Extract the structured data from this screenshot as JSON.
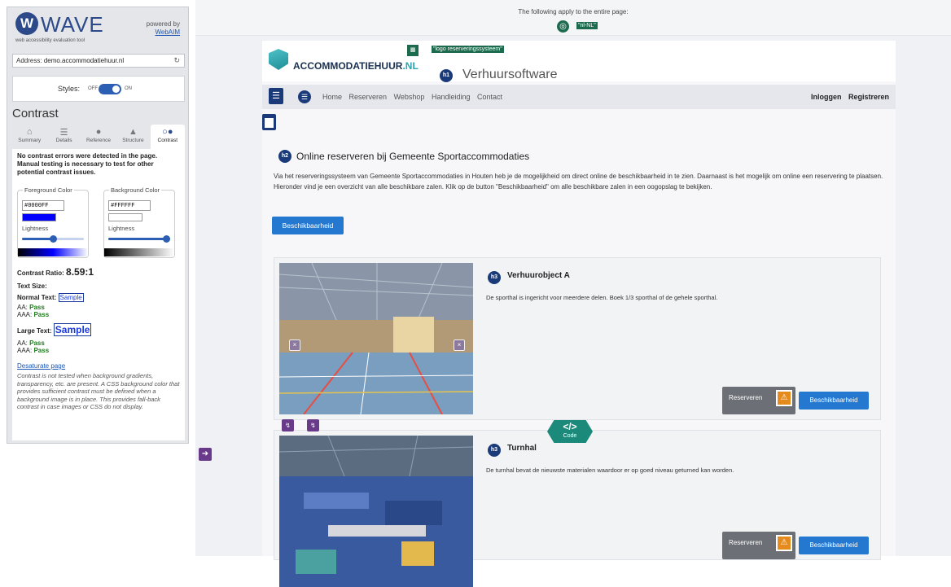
{
  "wave": {
    "title": "WAVE",
    "subtitle": "web accessibility evaluation tool",
    "powered_by": "powered by",
    "webaim": "WebAIM",
    "address_label": "Address:",
    "address_value": "demo.accommodatiehuur.nl",
    "styles_label": "Styles:",
    "styles_off": "OFF",
    "styles_on": "ON",
    "contrast_heading": "Contrast",
    "tabs": [
      {
        "label": "Summary",
        "icon": "home-icon"
      },
      {
        "label": "Details",
        "icon": "list-icon"
      },
      {
        "label": "Reference",
        "icon": "info-icon"
      },
      {
        "label": "Structure",
        "icon": "structure-icon"
      },
      {
        "label": "Contrast",
        "icon": "contrast-icon"
      }
    ],
    "contrast_message": "No contrast errors were detected in the page. Manual testing is necessary to test for other potential contrast issues.",
    "fg_label": "Foreground Color",
    "fg_value": "#0000FF",
    "fg_color": "#0000FF",
    "fg_lightness": 0.5,
    "bg_label": "Background Color",
    "bg_value": "#FFFFFF",
    "bg_color": "#FFFFFF",
    "bg_lightness": 1.0,
    "lightness_label": "Lightness",
    "ratio_label": "Contrast Ratio:",
    "ratio_value": "8.59:1",
    "text_size_label": "Text Size:",
    "normal_text_label": "Normal Text:",
    "sample": "Sample",
    "aa_label": "AA:",
    "aaa_label": "AAA:",
    "pass": "Pass",
    "large_text_label": "Large Text:",
    "desaturate": "Desaturate page",
    "note": "Contrast is not tested when background gradients, transparency, etc. are present. A CSS background color that provides sufficient contrast must be defined when a background image is in place. This provides fall-back contrast in case images or CSS do not display."
  },
  "topbar": {
    "applies": "The following apply to the entire page:",
    "lang": "\"nl-NL\""
  },
  "site": {
    "name_main": "ACCOMMODATIEHUUR",
    "name_suffix": ".NL",
    "logo_alt": "\"logo reserveringssysteem\"",
    "h1_badge": "h1",
    "h1": "Verhuursoftware",
    "nav_links": [
      "Home",
      "Reserveren",
      "Webshop",
      "Handleiding",
      "Contact"
    ],
    "login": "Inloggen",
    "register": "Registreren",
    "h2_badge": "h2",
    "h2": "Online reserveren bij Gemeente Sportaccommodaties",
    "intro": "Via het reserveringssysteem van Gemeente Sportaccommodaties in Houten heb je de mogelijkheid om direct online de beschikbaarheid in te zien. Daarnaast is het mogelijk om online een reservering te plaatsen. Hieronder vind je een overzicht van alle beschikbare zalen. Klik op de button \"Beschikbaarheid\" om alle beschikbare zalen in een oogopslag te bekijken.",
    "availability_button": "Beschikbaarheid",
    "h3_badge": "h3",
    "reserve_button": "Reserveren",
    "code_label": "Code",
    "cards": [
      {
        "title": "Verhuurobject A",
        "desc": "De sporthal is ingericht voor meerdere delen. Boek 1/3 sporthal of de gehele sporthal."
      },
      {
        "title": "Turnhal",
        "desc": "De turnhal bevat de nieuwste materialen waardoor er op goed niveau geturned kan worden."
      }
    ]
  }
}
